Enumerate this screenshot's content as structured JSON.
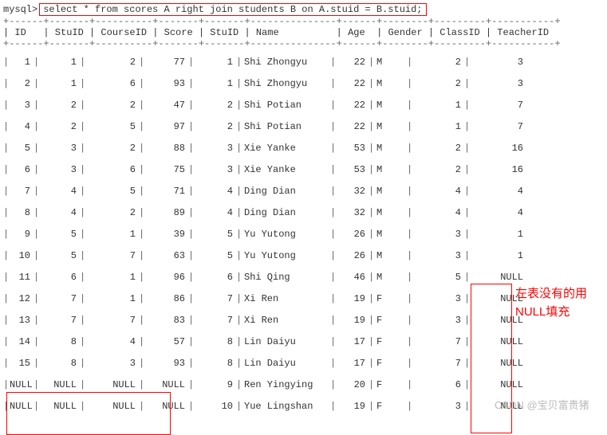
{
  "prompt": "mysql>",
  "query": "select * from scores A right join students B on A.stuid = B.stuid;",
  "header_sep_top": "+------+-------+----------+-------+-------+---------------+------+--------+---------+-----------+",
  "header_sep_bot": "+------+-------+----------+-------+-------+---------------+------+--------+---------+-----------+",
  "headers": [
    "ID",
    "StuID",
    "CourseID",
    "Score",
    "StuID",
    "Name",
    "Age",
    "Gender",
    "ClassID",
    "TeacherID"
  ],
  "rows": [
    {
      "id": "1",
      "stuid": "1",
      "course": "2",
      "score": "77",
      "stuid2": "1",
      "name": "Shi Zhongyu",
      "age": "22",
      "gender": "M",
      "class": "2",
      "teacher": "3"
    },
    {
      "id": "2",
      "stuid": "1",
      "course": "6",
      "score": "93",
      "stuid2": "1",
      "name": "Shi Zhongyu",
      "age": "22",
      "gender": "M",
      "class": "2",
      "teacher": "3"
    },
    {
      "id": "3",
      "stuid": "2",
      "course": "2",
      "score": "47",
      "stuid2": "2",
      "name": "Shi Potian",
      "age": "22",
      "gender": "M",
      "class": "1",
      "teacher": "7"
    },
    {
      "id": "4",
      "stuid": "2",
      "course": "5",
      "score": "97",
      "stuid2": "2",
      "name": "Shi Potian",
      "age": "22",
      "gender": "M",
      "class": "1",
      "teacher": "7"
    },
    {
      "id": "5",
      "stuid": "3",
      "course": "2",
      "score": "88",
      "stuid2": "3",
      "name": "Xie Yanke",
      "age": "53",
      "gender": "M",
      "class": "2",
      "teacher": "16"
    },
    {
      "id": "6",
      "stuid": "3",
      "course": "6",
      "score": "75",
      "stuid2": "3",
      "name": "Xie Yanke",
      "age": "53",
      "gender": "M",
      "class": "2",
      "teacher": "16"
    },
    {
      "id": "7",
      "stuid": "4",
      "course": "5",
      "score": "71",
      "stuid2": "4",
      "name": "Ding Dian",
      "age": "32",
      "gender": "M",
      "class": "4",
      "teacher": "4"
    },
    {
      "id": "8",
      "stuid": "4",
      "course": "2",
      "score": "89",
      "stuid2": "4",
      "name": "Ding Dian",
      "age": "32",
      "gender": "M",
      "class": "4",
      "teacher": "4"
    },
    {
      "id": "9",
      "stuid": "5",
      "course": "1",
      "score": "39",
      "stuid2": "5",
      "name": "Yu Yutong",
      "age": "26",
      "gender": "M",
      "class": "3",
      "teacher": "1"
    },
    {
      "id": "10",
      "stuid": "5",
      "course": "7",
      "score": "63",
      "stuid2": "5",
      "name": "Yu Yutong",
      "age": "26",
      "gender": "M",
      "class": "3",
      "teacher": "1"
    },
    {
      "id": "11",
      "stuid": "6",
      "course": "1",
      "score": "96",
      "stuid2": "6",
      "name": "Shi Qing",
      "age": "46",
      "gender": "M",
      "class": "5",
      "teacher": "NULL"
    },
    {
      "id": "12",
      "stuid": "7",
      "course": "1",
      "score": "86",
      "stuid2": "7",
      "name": "Xi Ren",
      "age": "19",
      "gender": "F",
      "class": "3",
      "teacher": "NULL"
    },
    {
      "id": "13",
      "stuid": "7",
      "course": "7",
      "score": "83",
      "stuid2": "7",
      "name": "Xi Ren",
      "age": "19",
      "gender": "F",
      "class": "3",
      "teacher": "NULL"
    },
    {
      "id": "14",
      "stuid": "8",
      "course": "4",
      "score": "57",
      "stuid2": "8",
      "name": "Lin Daiyu",
      "age": "17",
      "gender": "F",
      "class": "7",
      "teacher": "NULL"
    },
    {
      "id": "15",
      "stuid": "8",
      "course": "3",
      "score": "93",
      "stuid2": "8",
      "name": "Lin Daiyu",
      "age": "17",
      "gender": "F",
      "class": "7",
      "teacher": "NULL"
    },
    {
      "id": "NULL",
      "stuid": "NULL",
      "course": "NULL",
      "score": "NULL",
      "stuid2": "9",
      "name": "Ren Yingying",
      "age": "20",
      "gender": "F",
      "class": "6",
      "teacher": "NULL"
    },
    {
      "id": "NULL",
      "stuid": "NULL",
      "course": "NULL",
      "score": "NULL",
      "stuid2": "10",
      "name": "Yue Lingshan",
      "age": "19",
      "gender": "F",
      "class": "3",
      "teacher": "NULL"
    }
  ],
  "annotation_line1": "左表没有的用",
  "annotation_line2": "NULL填充",
  "watermark": "CSDN @宝贝富贵猪"
}
